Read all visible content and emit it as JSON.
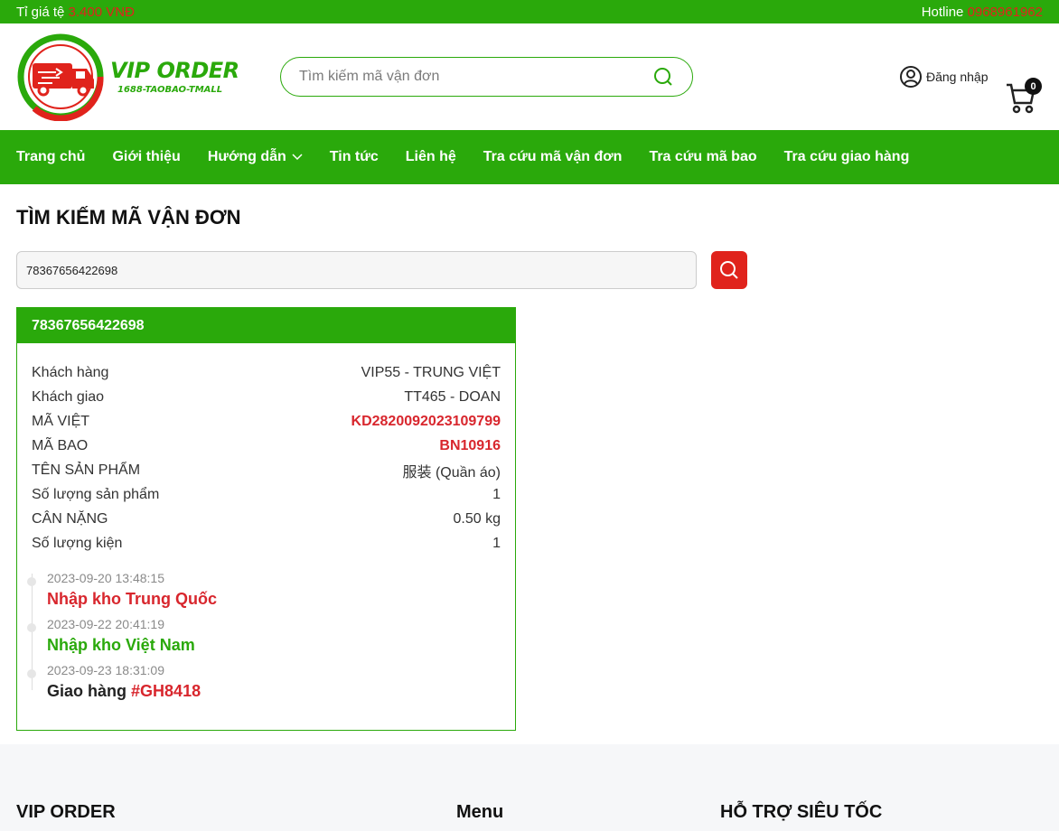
{
  "topbar": {
    "rate_label": "Tỉ giá tệ",
    "rate_value": "3.400 VNĐ",
    "hotline_label": "Hotline",
    "hotline_value": "0968961962"
  },
  "logo": {
    "name": "VIP ORDER",
    "tagline": "1688-TAOBAO-TMALL"
  },
  "header_search": {
    "placeholder": "Tìm kiếm mã vận đơn"
  },
  "account": {
    "login_label": "Đăng nhập",
    "cart_count": "0"
  },
  "nav": {
    "items": [
      "Trang chủ",
      "Giới thiệu",
      "Hướng dẫn",
      "Tin tức",
      "Liên hệ",
      "Tra cứu mã vận đơn",
      "Tra cứu mã bao",
      "Tra cứu giao hàng"
    ]
  },
  "page": {
    "title": "TÌM KIẾM MÃ VẬN ĐƠN"
  },
  "tracking_search": {
    "value": "78367656422698"
  },
  "result": {
    "code": "78367656422698",
    "rows": [
      {
        "label": "Khách hàng",
        "value": "VIP55 - TRUNG VIỆT"
      },
      {
        "label": "Khách giao",
        "value": "TT465 - DOAN"
      },
      {
        "label": "MÃ VIỆT",
        "value": "KD2820092023109799"
      },
      {
        "label": "MÃ BAO",
        "value": "BN10916"
      },
      {
        "label": "TÊN SẢN PHẨM",
        "value": "服装 (Quần áo)"
      },
      {
        "label": "Số lượng sản phẩm",
        "value": "1"
      },
      {
        "label": "CÂN NẶNG",
        "value": "0.50 kg"
      },
      {
        "label": "Số lượng kiện",
        "value": "1"
      }
    ],
    "timeline": [
      {
        "date": "2023-09-20 13:48:15",
        "status": "Nhập kho Trung Quốc"
      },
      {
        "date": "2023-09-22 20:41:19",
        "status": "Nhập kho Việt Nam"
      },
      {
        "date": "2023-09-23 18:31:09",
        "status": "Giao hàng",
        "code": "#GH8418"
      }
    ]
  },
  "footer": {
    "col1": "VIP ORDER",
    "col2": "Menu",
    "col3": "HỖ TRỢ SIÊU TỐC"
  },
  "colors": {
    "green": "#2aa90b",
    "red": "#e0231c"
  }
}
